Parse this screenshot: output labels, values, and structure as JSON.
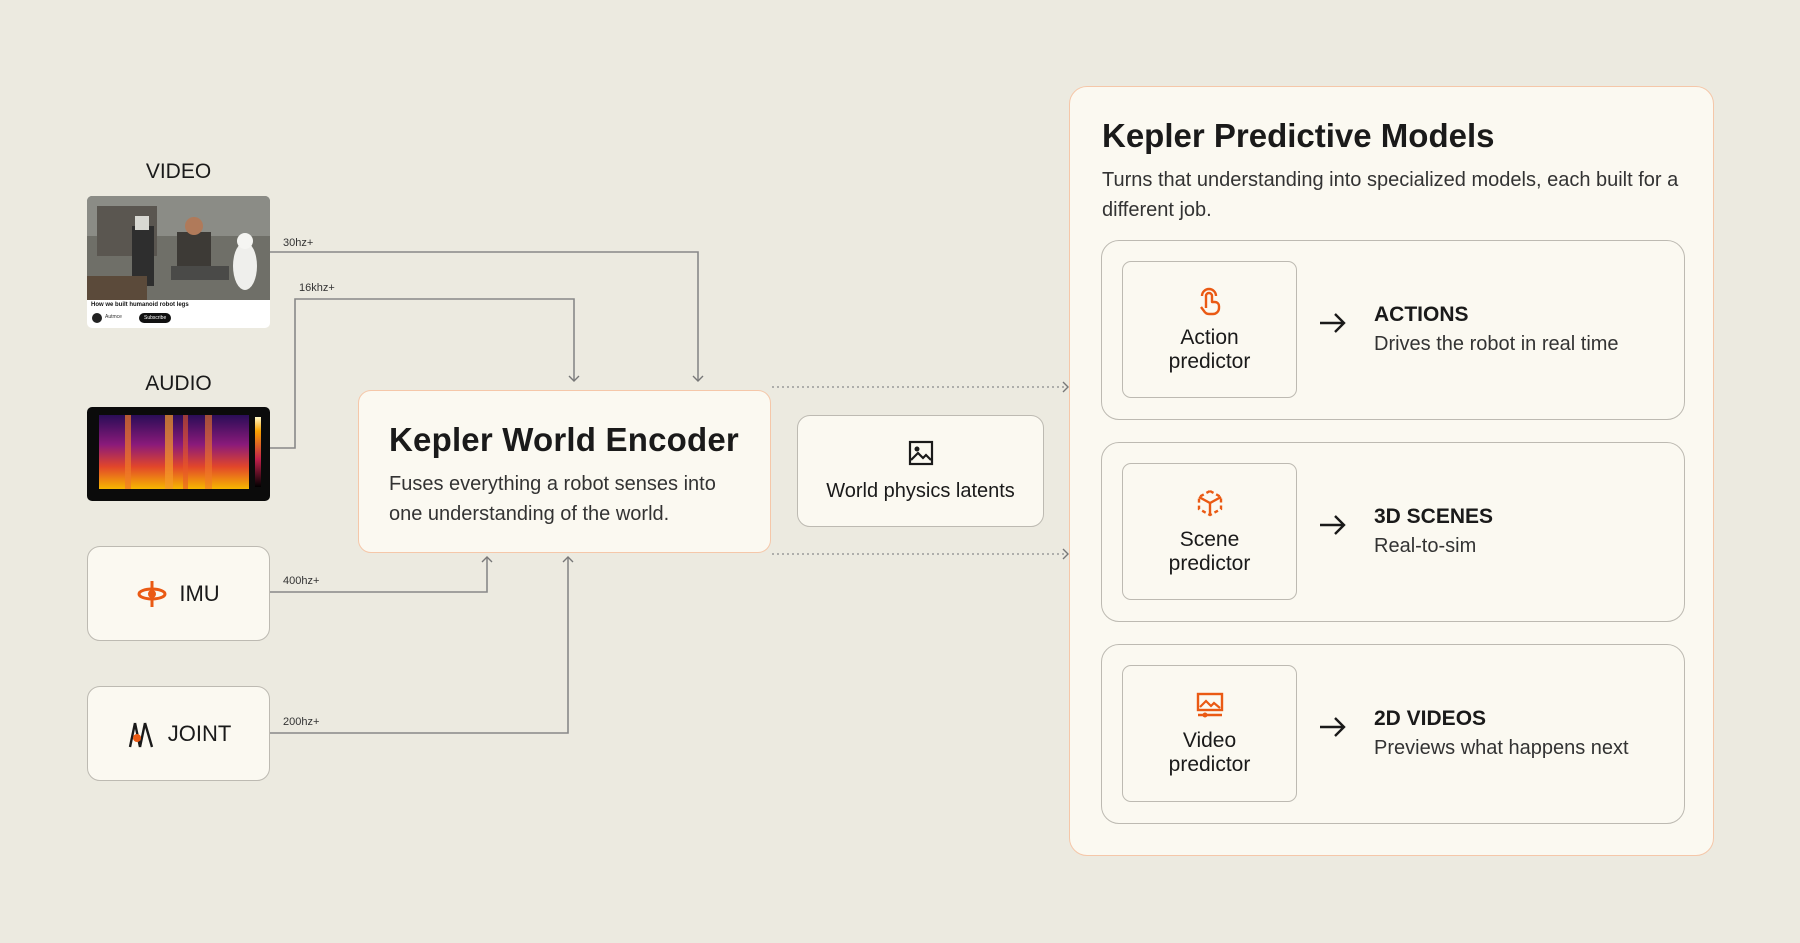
{
  "inputs": {
    "video": {
      "label": "VIDEO",
      "rate": "30hz+",
      "thumb_caption": "How we built humanoid robot legs",
      "thumb_channel": "Autmce",
      "thumb_subscribe": "Subscribe"
    },
    "audio": {
      "label": "AUDIO",
      "rate": "16khz+"
    },
    "imu": {
      "label": "IMU",
      "rate": "400hz+",
      "icon": "gyroscope-icon"
    },
    "joint": {
      "label": "JOINT",
      "rate": "200hz+",
      "icon": "joint-icon"
    }
  },
  "encoder": {
    "title": "Kepler World Encoder",
    "description": "Fuses everything a robot senses into one understanding of the world."
  },
  "latents": {
    "label": "World physics latents",
    "icon": "image-icon"
  },
  "models": {
    "title": "Kepler Predictive Models",
    "description": "Turns that understanding into specialized models, each built for a different job.",
    "items": [
      {
        "predictor": "Action predictor",
        "output_title": "ACTIONS",
        "output_desc": "Drives the robot in real time",
        "icon": "touch-icon"
      },
      {
        "predictor": "Scene predictor",
        "output_title": "3D SCENES",
        "output_desc": "Real-to-sim",
        "icon": "cube-icon"
      },
      {
        "predictor": "Video predictor",
        "output_title": "2D VIDEOS",
        "output_desc": "Previews what happens next",
        "icon": "video-icon"
      }
    ]
  },
  "colors": {
    "accent": "#ea5a14",
    "background": "#eceae0",
    "card": "#fbf9f1",
    "border": "#bdbab2",
    "highlight_border": "#f5c7a9"
  }
}
